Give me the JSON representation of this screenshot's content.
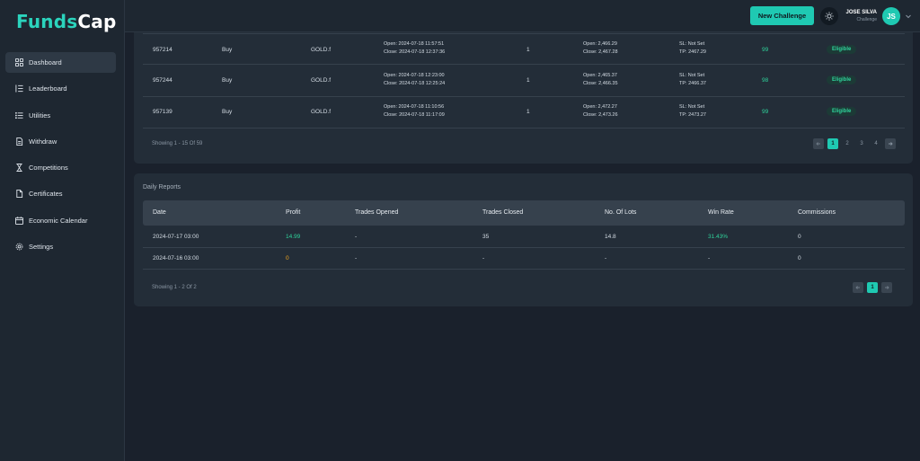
{
  "brand": {
    "part1": "Funds",
    "part2": "Cap"
  },
  "nav": {
    "items": [
      {
        "label": "Dashboard",
        "icon": "grid-icon"
      },
      {
        "label": "Leaderboard",
        "icon": "list-ordered-icon"
      },
      {
        "label": "Utilities",
        "icon": "list-icon"
      },
      {
        "label": "Withdraw",
        "icon": "document-icon"
      },
      {
        "label": "Competitions",
        "icon": "hourglass-icon"
      },
      {
        "label": "Certificates",
        "icon": "file-icon"
      },
      {
        "label": "Economic Calendar",
        "icon": "calendar-icon"
      },
      {
        "label": "Settings",
        "icon": "gear-icon"
      }
    ]
  },
  "topbar": {
    "new_challenge": "New Challenge",
    "user_name": "JOSE SILVA",
    "user_role": "Challenge",
    "avatar_initials": "JS"
  },
  "trades": {
    "rows": [
      {
        "id": "957214",
        "type": "Buy",
        "symbol": "GOLD.f",
        "open_time": "Open: 2024-07-18 11:57:51",
        "close_time": "Close: 2024-07-18 12:37:36",
        "lots": "1",
        "open_price": "Open: 2,466.29",
        "close_price": "Close: 2,467.28",
        "sl": "SL: Not Set",
        "tp": "TP: 2467.29",
        "profit": "99",
        "status": "Eligible"
      },
      {
        "id": "957244",
        "type": "Buy",
        "symbol": "GOLD.f",
        "open_time": "Open: 2024-07-18 12:23:00",
        "close_time": "Close: 2024-07-18 12:25:24",
        "lots": "1",
        "open_price": "Open: 2,465.37",
        "close_price": "Close: 2,466.35",
        "sl": "SL: Not Set",
        "tp": "TP: 2466.37",
        "profit": "98",
        "status": "Eligible"
      },
      {
        "id": "957139",
        "type": "Buy",
        "symbol": "GOLD.f",
        "open_time": "Open: 2024-07-18 11:10:56",
        "close_time": "Close: 2024-07-18 11:17:09",
        "lots": "1",
        "open_price": "Open: 2,472.27",
        "close_price": "Close: 2,473.26",
        "sl": "SL: Not Set",
        "tp": "TP: 2473.27",
        "profit": "99",
        "status": "Eligible"
      }
    ],
    "showing": "Showing 1 - 15 Of 59",
    "pages": [
      "1",
      "2",
      "3",
      "4"
    ],
    "active_page": "1"
  },
  "daily_reports": {
    "title": "Daily Reports",
    "headers": [
      "Date",
      "Profit",
      "Trades Opened",
      "Trades Closed",
      "No. Of Lots",
      "Win Rate",
      "Commissions"
    ],
    "rows": [
      {
        "date": "2024-07-17 03:00",
        "profit": "14.99",
        "opened": "-",
        "closed": "35",
        "lots": "14.8",
        "win_rate": "31.43%",
        "commissions": "0"
      },
      {
        "date": "2024-07-16 03:00",
        "profit": "0",
        "opened": "-",
        "closed": "-",
        "lots": "-",
        "win_rate": "-",
        "commissions": "0"
      }
    ],
    "showing": "Showing 1 - 2 Of 2",
    "pages": [
      "1"
    ],
    "active_page": "1"
  },
  "colors": {
    "accent": "#1fc9b2",
    "positive": "#2fd39b",
    "neutral_profit": "#f0a51e",
    "background": "#1a212c",
    "card": "#232d38"
  }
}
